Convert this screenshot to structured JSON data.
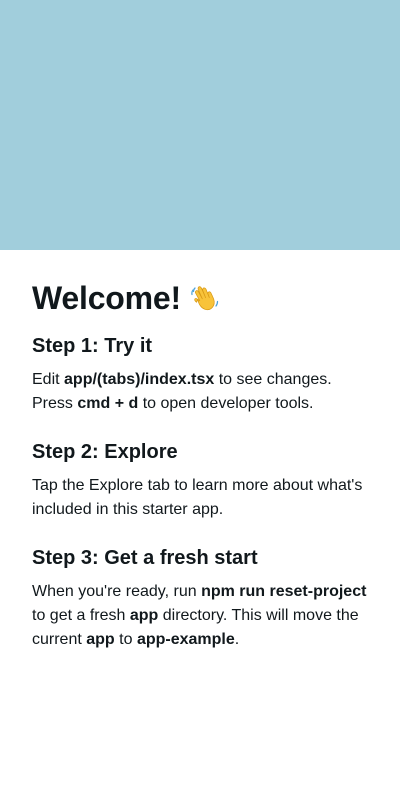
{
  "header": {
    "banner_color": "#A1CEDC"
  },
  "main": {
    "title": "Welcome!",
    "title_icon": "waving-hand-icon",
    "steps": [
      {
        "title": "Step 1: Try it",
        "segments": [
          "Edit ",
          "app/(tabs)/index.tsx",
          " to see changes. Press ",
          "cmd + d",
          " to open developer tools."
        ]
      },
      {
        "title": "Step 2: Explore",
        "text": "Tap the Explore tab to learn more about what's included in this starter app."
      },
      {
        "title": "Step 3: Get a fresh start",
        "segments": [
          "When you're ready, run ",
          "npm run reset-project",
          " to get a fresh ",
          "app",
          " directory. This will move the current ",
          "app",
          " to ",
          "app-example",
          "."
        ]
      }
    ]
  }
}
